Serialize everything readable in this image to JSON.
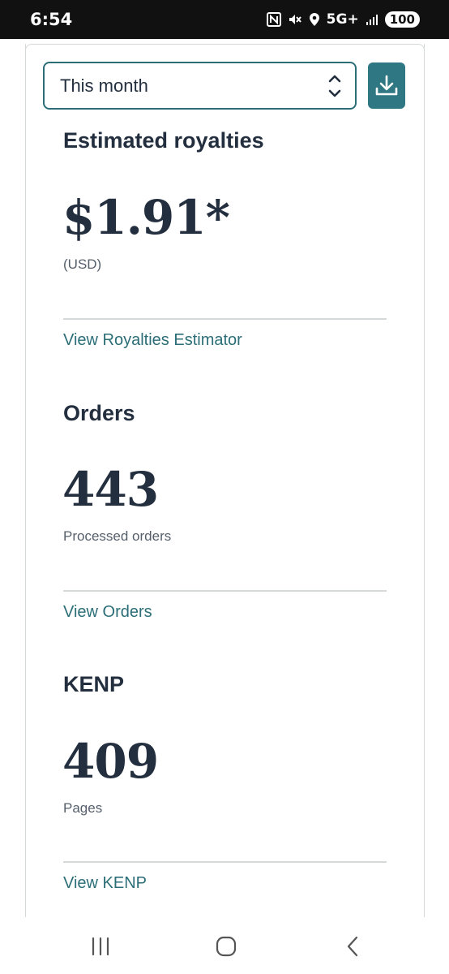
{
  "status_bar": {
    "time": "6:54",
    "network": "5G+",
    "battery": "100"
  },
  "range_select": {
    "value": "This month"
  },
  "royalties": {
    "title": "Estimated royalties",
    "value": "$1.91*",
    "currency": "(USD)",
    "link": "View Royalties Estimator"
  },
  "orders": {
    "title": "Orders",
    "value": "443",
    "label": "Processed orders",
    "link": "View Orders"
  },
  "kenp": {
    "title": "KENP",
    "value": "409",
    "label": "Pages",
    "link": "View KENP"
  },
  "colors": {
    "accent": "#2b6e77",
    "text": "#232f3e",
    "divider": "#d5d9d9"
  }
}
